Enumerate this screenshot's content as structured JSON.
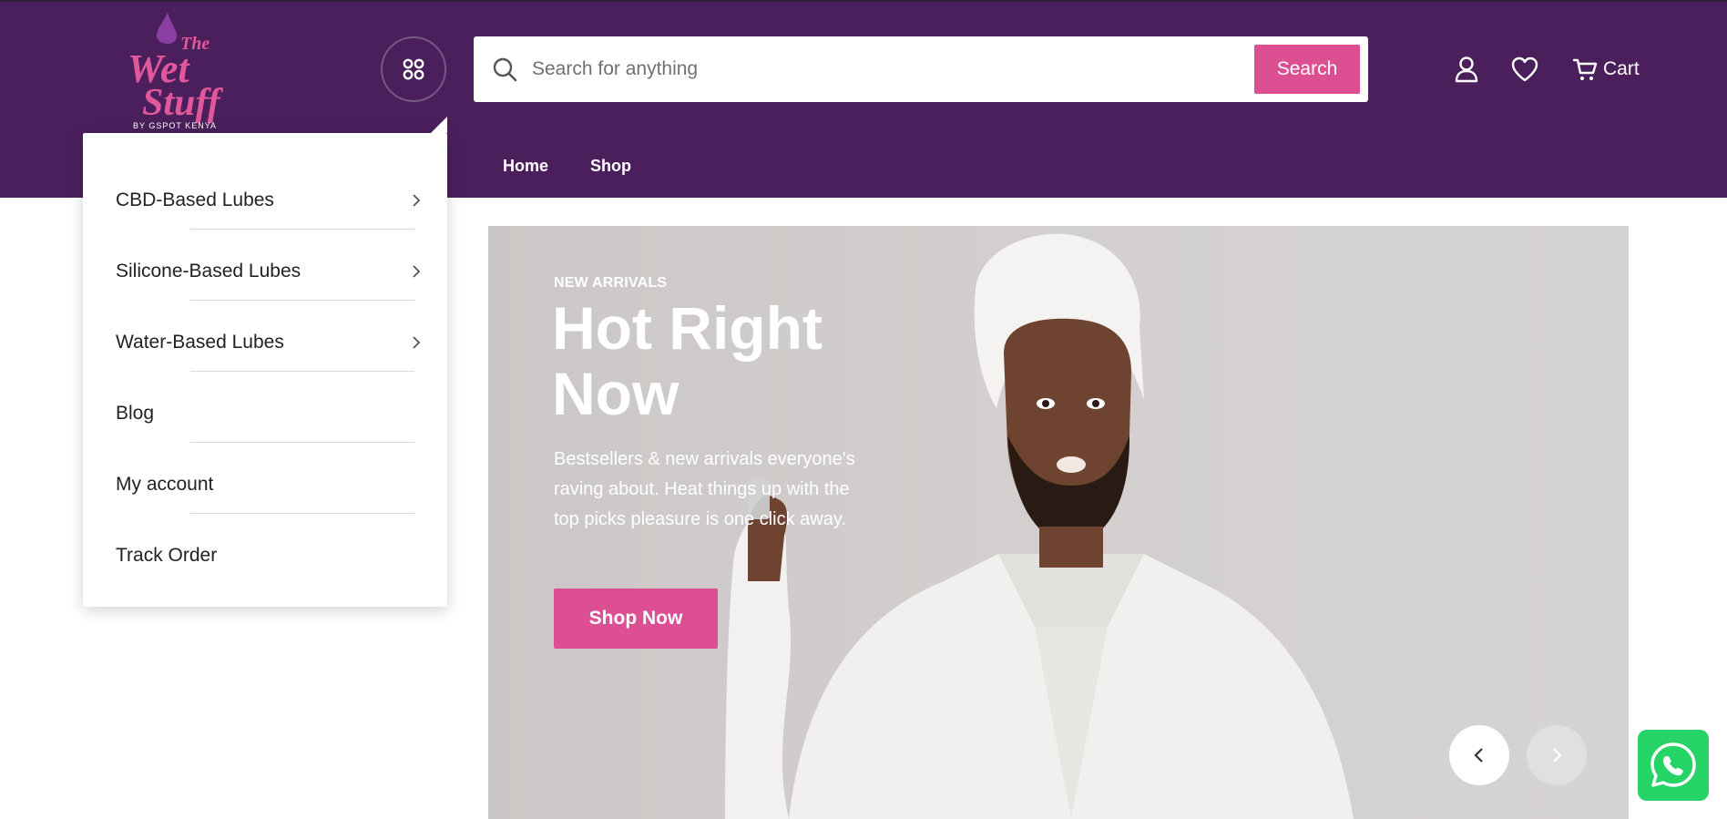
{
  "brand": {
    "logo_word_top": "The",
    "logo_word_1": "Wet",
    "logo_word_2": "Stuff",
    "logo_tagline": "BY GSPOT KENYA",
    "colors": {
      "header": "#4a1f5b",
      "accent": "#dc4f93",
      "logo_pink": "#e0579b"
    }
  },
  "search": {
    "placeholder": "Search for anything",
    "button_label": "Search"
  },
  "header_actions": {
    "account_icon": "user-icon",
    "wishlist_icon": "heart-icon",
    "cart_icon": "cart-icon",
    "cart_label": "Cart"
  },
  "nav": {
    "items": [
      {
        "label": "Home"
      },
      {
        "label": "Shop"
      }
    ]
  },
  "category_menu": {
    "toggle_icon": "grid-dots-icon",
    "items": [
      {
        "label": "CBD-Based Lubes",
        "has_submenu": true
      },
      {
        "label": "Silicone-Based Lubes",
        "has_submenu": true
      },
      {
        "label": "Water-Based Lubes",
        "has_submenu": true
      },
      {
        "label": "Blog",
        "has_submenu": false
      },
      {
        "label": "My account",
        "has_submenu": false
      },
      {
        "label": "Track Order",
        "has_submenu": false
      }
    ]
  },
  "hero": {
    "tag": "NEW ARRIVALS",
    "title": "Hot Right Now",
    "subtitle": "Bestsellers & new arrivals everyone's raving about. Heat things up with the top picks pleasure is one click away.",
    "cta_label": "Shop Now",
    "prev_icon": "chevron-left-icon",
    "next_icon": "chevron-right-icon"
  },
  "floating": {
    "whatsapp_icon": "whatsapp-icon"
  }
}
